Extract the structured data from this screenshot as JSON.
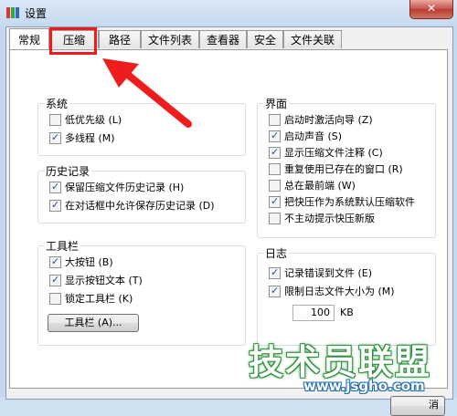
{
  "window": {
    "title": "设置",
    "close_label": "✕"
  },
  "tabs": [
    {
      "label": "常规",
      "active": true
    },
    {
      "label": "压缩",
      "active": false
    },
    {
      "label": "路径",
      "active": false
    },
    {
      "label": "文件列表",
      "active": false
    },
    {
      "label": "查看器",
      "active": false
    },
    {
      "label": "安全",
      "active": false
    },
    {
      "label": "文件关联",
      "active": false
    }
  ],
  "system": {
    "title": "系统",
    "items": [
      {
        "label": "低优先级 (L)",
        "checked": false
      },
      {
        "label": "多线程 (M)",
        "checked": true
      }
    ]
  },
  "history": {
    "title": "历史记录",
    "items": [
      {
        "label": "保留压缩文件历史记录 (H)",
        "checked": true
      },
      {
        "label": "在对话框中允许保存历史记录 (D)",
        "checked": true
      }
    ]
  },
  "toolbar": {
    "title": "工具栏",
    "items": [
      {
        "label": "大按钮 (B)",
        "checked": true
      },
      {
        "label": "显示按钮文本 (T)",
        "checked": true
      },
      {
        "label": "锁定工具栏 (K)",
        "checked": false
      }
    ],
    "button_label": "工具栏 (A)..."
  },
  "interface": {
    "title": "界面",
    "items": [
      {
        "label": "启动时激活向导 (Z)",
        "checked": false
      },
      {
        "label": "启动声音 (S)",
        "checked": true
      },
      {
        "label": "显示压缩文件注释 (C)",
        "checked": true
      },
      {
        "label": "重复使用已存在的窗口 (R)",
        "checked": false
      },
      {
        "label": "总在最前端 (W)",
        "checked": false
      },
      {
        "label": "把快压作为系统默认压缩软件",
        "checked": true
      },
      {
        "label": "不主动提示快压新版",
        "checked": false
      }
    ]
  },
  "log": {
    "title": "日志",
    "items": [
      {
        "label": "记录错误到文件 (E)",
        "checked": true
      },
      {
        "label": "限制日志文件大小为 (M)",
        "checked": true
      }
    ],
    "size_value": "100",
    "size_unit": "KB"
  },
  "bottom": {
    "partial_button_label": "消"
  },
  "watermark": {
    "text": "技术员联盟",
    "url": "www.jsgho.com"
  },
  "colors": {
    "highlight": "#ee1c1c",
    "arrow": "#ee1c1c",
    "check": "#2b4a8a"
  }
}
